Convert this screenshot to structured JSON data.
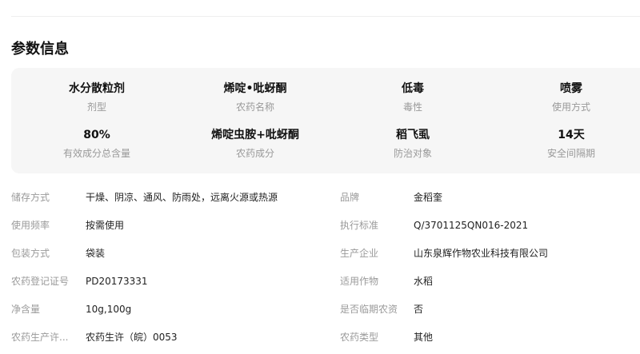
{
  "section": {
    "title": "参数信息"
  },
  "summary": [
    {
      "value": "水分散粒剂",
      "label": "剂型"
    },
    {
      "value": "烯啶•吡蚜酮",
      "label": "农药名称"
    },
    {
      "value": "低毒",
      "label": "毒性"
    },
    {
      "value": "喷雾",
      "label": "使用方式"
    },
    {
      "value": "80%",
      "label": "有效成分总含量"
    },
    {
      "value": "烯啶虫胺+吡蚜酮",
      "label": "农药成分"
    },
    {
      "value": "稻飞虱",
      "label": "防治对象"
    },
    {
      "value": "14天",
      "label": "安全间隔期"
    }
  ],
  "details": {
    "left": [
      {
        "label": "储存方式",
        "value": "干燥、阴凉、通风、防雨处，远离火源或热源"
      },
      {
        "label": "使用频率",
        "value": "按需使用"
      },
      {
        "label": "包装方式",
        "value": "袋装"
      },
      {
        "label": "农药登记证号",
        "value": "PD20173331"
      },
      {
        "label": "净含量",
        "value": "10g,100g"
      },
      {
        "label": "农药生产许...",
        "value": "农药生许（皖）0053"
      }
    ],
    "right": [
      {
        "label": "品牌",
        "value": "金稻奎"
      },
      {
        "label": "执行标准",
        "value": "Q/3701125QN016-2021"
      },
      {
        "label": "生产企业",
        "value": "山东泉辉作物农业科技有限公司"
      },
      {
        "label": "适用作物",
        "value": "水稻"
      },
      {
        "label": "是否临期农资",
        "value": "否"
      },
      {
        "label": "农药类型",
        "value": "其他"
      }
    ]
  }
}
